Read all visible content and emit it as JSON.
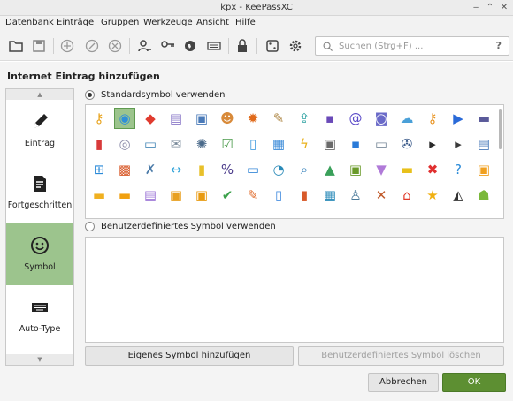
{
  "window": {
    "title": "kpx - KeePassXC"
  },
  "menu": [
    "Datenbank",
    "Einträge",
    "Gruppen",
    "Werkzeuge",
    "Ansicht",
    "Hilfe"
  ],
  "search": {
    "placeholder": "Suchen (Strg+F) ...",
    "help": "?"
  },
  "header": {
    "title": "Internet  Eintrag hinzufügen"
  },
  "sidebar": [
    {
      "label": "Eintrag",
      "icon": "pencil-icon"
    },
    {
      "label": "Fortgeschritten",
      "icon": "document-edit-icon"
    },
    {
      "label": "Symbol",
      "icon": "smiley-icon",
      "selected": true
    },
    {
      "label": "Auto-Type",
      "icon": "keyboard-icon"
    }
  ],
  "icons_section": {
    "standard_label": "Standardsymbol verwenden",
    "custom_label": "Benutzerdefiniertes Symbol verwenden",
    "standard_selected": true,
    "selected_icon_index": 1
  },
  "icon_grid": [
    "key-icon",
    "globe-icon",
    "warning-icon",
    "server-icon",
    "clipboard-icon",
    "user-icon",
    "gears-icon",
    "notepad-icon",
    "upload-icon",
    "contact-card-icon",
    "email-at-icon",
    "camera-icon",
    "cloud-network-icon",
    "keys-icon",
    "plug-icon",
    "projector-icon",
    "bookmark-icon",
    "cd-icon",
    "monitor-icon",
    "envelope-open-icon",
    "gear-icon",
    "checklist-icon",
    "file-icon",
    "window-icon",
    "lightning-icon",
    "safe-icon",
    "floppy-icon",
    "computer-icon",
    "film-reel-icon",
    "terminal-icon",
    "console-icon",
    "printer-icon",
    "network-icon",
    "brick-wall-icon",
    "wrench-icon",
    "resize-icon",
    "archive-icon",
    "percent-icon",
    "desktop-icon",
    "clock-icon",
    "magnifier-icon",
    "image-icon",
    "chip-icon",
    "trash-icon",
    "sticky-note-icon",
    "cancel-icon",
    "help-icon",
    "package-icon",
    "folder-icon",
    "folder-open-icon",
    "database-folder-icon",
    "lock-open-icon",
    "lock-icon",
    "checkmark-icon",
    "pen-icon",
    "image-file-icon",
    "address-book-icon",
    "spreadsheet-icon",
    "user-computer-icon",
    "tools-icon",
    "home-icon",
    "star-icon",
    "linux-icon",
    "android-icon"
  ],
  "buttons": {
    "add_custom": "Eigenes Symbol hinzufügen",
    "delete_custom": "Benutzerdefiniertes Symbol löschen",
    "cancel": "Abbrechen",
    "ok": "OK"
  },
  "colors": {
    "accent": "#5d8f32",
    "selection": "#9cc48d"
  }
}
